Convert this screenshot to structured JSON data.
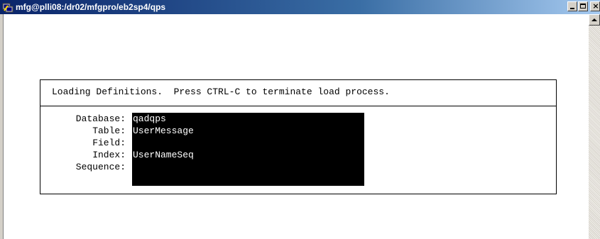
{
  "window": {
    "title": "mfg@plli08:/dr02/mfgpro/eb2sp4/qps",
    "icon": "putty-terminal-icon",
    "controls": {
      "minimize": "_",
      "maximize": "□",
      "close": "x"
    }
  },
  "terminal": {
    "message": "Loading Definitions.  Press CTRL-C to terminate load process.",
    "fields": {
      "database": {
        "label": "Database:",
        "value": "qadqps"
      },
      "table": {
        "label": "Table:",
        "value": "UserMessage"
      },
      "field": {
        "label": "Field:",
        "value": ""
      },
      "index": {
        "label": "Index:",
        "value": "UserNameSeq"
      },
      "sequence": {
        "label": "Sequence:",
        "value": ""
      }
    }
  },
  "colors": {
    "titlebar_start": "#0a246a",
    "titlebar_end": "#a6caf0",
    "value_background": "#000000",
    "value_text": "#ffffff"
  }
}
